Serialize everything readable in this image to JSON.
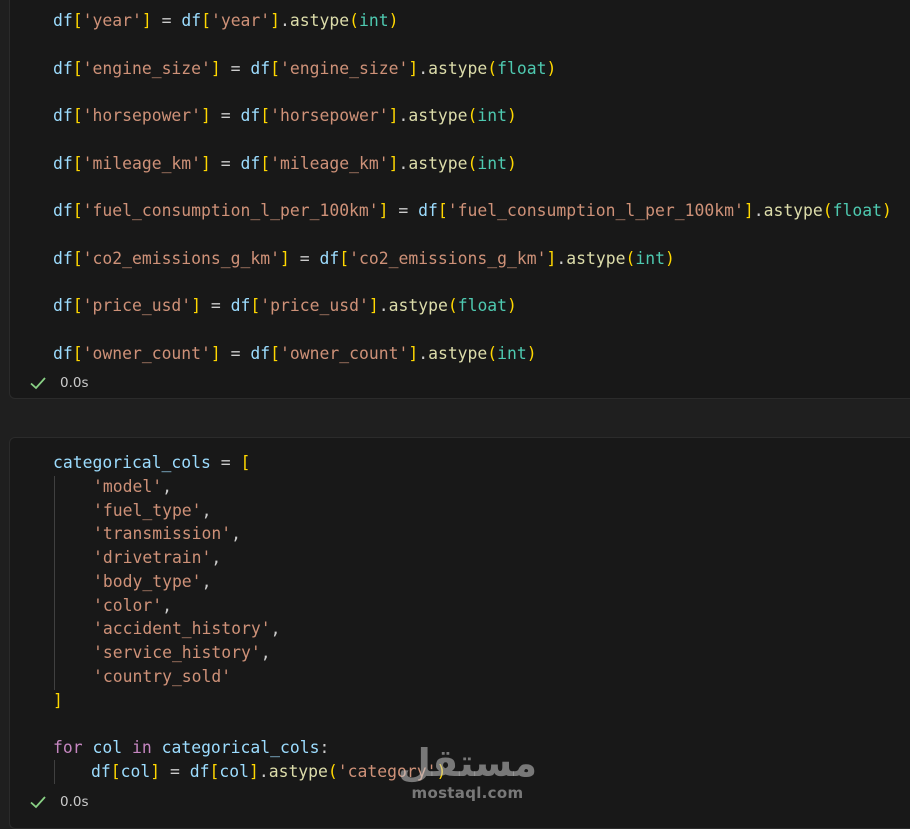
{
  "cell1": {
    "lines": [
      {
        "col": "year",
        "type": "int"
      },
      {
        "col": "engine_size",
        "type": "float"
      },
      {
        "col": "horsepower",
        "type": "int"
      },
      {
        "col": "mileage_km",
        "type": "int"
      },
      {
        "col": "fuel_consumption_l_per_100km",
        "type": "float"
      },
      {
        "col": "co2_emissions_g_km",
        "type": "int"
      },
      {
        "col": "price_usd",
        "type": "float"
      },
      {
        "col": "owner_count",
        "type": "int"
      }
    ],
    "code_tokens": {
      "df": "df",
      "method": "astype",
      "assign": " = ",
      "dot": ".",
      "q": "'"
    },
    "status": {
      "icon": "check-icon",
      "time": "0.0s"
    }
  },
  "cell2": {
    "var_name": "categorical_cols",
    "list_items": [
      "'model',",
      "'fuel_type',",
      "'transmission',",
      "'drivetrain',",
      "'body_type',",
      "'color',",
      "'accident_history',",
      "'service_history',",
      "'country_sold'"
    ],
    "for_kw": "for",
    "loop_var": "col",
    "in_kw": "in",
    "loop_body": {
      "df": "df",
      "var": "col",
      "method": "astype",
      "arg": "'category'"
    },
    "status": {
      "icon": "check-icon",
      "time": "0.0s"
    }
  },
  "watermark": {
    "arabic": "مستقل",
    "latin": "mostaql.com"
  },
  "colors": {
    "background": "#1f1f1f",
    "cell_bg": "#181818",
    "variable": "#9cdcfe",
    "string": "#ce9178",
    "bracket_gold": "#ffd700",
    "bracket_purple": "#da70d6",
    "type": "#4ec9b0",
    "function": "#dcdcaa",
    "keyword": "#c586c0",
    "success": "#89d185"
  }
}
